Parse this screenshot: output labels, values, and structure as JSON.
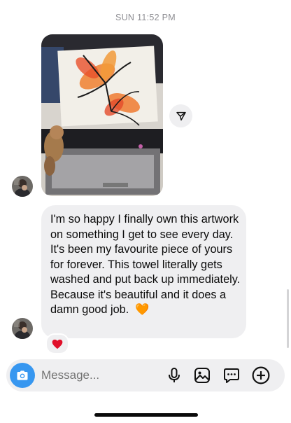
{
  "header": {
    "timestamp": "SUN 11:52 PM"
  },
  "conversation": {
    "photo_message": {
      "icon": "photo-attachment"
    },
    "text_message": {
      "text": "I'm so happy I finally own this artwork on something I get to see every day. It's been my favourite piece of yours for forever.  This towel literally gets washed and put back up immediately. Because it's beautiful and it does a damn good job.",
      "emoji": "🧡"
    },
    "reaction": {
      "emoji": "❤️"
    }
  },
  "composer": {
    "placeholder": "Message..."
  },
  "colors": {
    "accent": "#3797f0",
    "bubble": "#efeff1",
    "timestamp": "#8e8e93"
  }
}
